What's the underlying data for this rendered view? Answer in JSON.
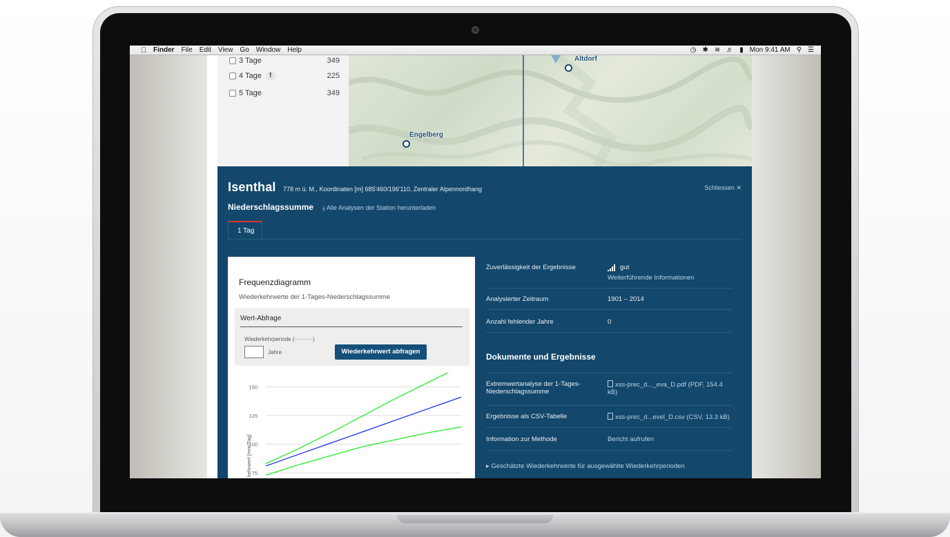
{
  "menubar": {
    "items": [
      "Finder",
      "File",
      "Edit",
      "View",
      "Go",
      "Window",
      "Help"
    ],
    "clock": "Mon 9:41 AM"
  },
  "checkboxes": [
    {
      "label": "3 Tage",
      "count": "349",
      "warn": ""
    },
    {
      "label": "4 Tage",
      "count": "225",
      "warn": "!"
    },
    {
      "label": "5 Tage",
      "count": "349",
      "warn": ""
    }
  ],
  "map": {
    "places": [
      "Altdorf",
      "Engelberg"
    ]
  },
  "station": {
    "name": "Isenthal",
    "meta": "778 m ü. M., Koordinaten [m] 685'460/196'110, Zentraler Alpennordhang",
    "close": "Schliessen",
    "subtitle": "Niederschlagssumme",
    "download": "Alle Analysen der Station herunterladen",
    "tab": "1 Tag"
  },
  "chart_card": {
    "title": "Frequenzdiagramm",
    "subtitle": "Wiederkehrwerte der 1-Tages-Niederschlagssumme",
    "query": {
      "title": "Wert-Abfrage",
      "label": "Wiederkehrperiode (··········)",
      "unit": "Jahre",
      "button": "Wiederkehrwert abfragen"
    }
  },
  "chart_data": {
    "type": "line",
    "ylabel": "kehrwert [mm/Tag]",
    "yticks": [
      75,
      100,
      125,
      150
    ],
    "ylim": [
      60,
      155
    ],
    "x": [
      0,
      1,
      2,
      3,
      4,
      5,
      6
    ],
    "series": [
      {
        "values": [
          81,
          91,
          101,
          111,
          121,
          131,
          141
        ],
        "color": "#2a3ee8"
      },
      {
        "values": [
          83,
          96,
          110,
          125,
          140,
          154,
          168
        ],
        "color": "#33ee33"
      },
      {
        "values": [
          73,
          82,
          90,
          98,
          104,
          110,
          115
        ],
        "color": "#33ee33"
      }
    ]
  },
  "info": {
    "reliability_label": "Zuverlässigkeit der Ergebnisse",
    "reliability_value": "gut",
    "reliability_link": "Weiterführende Informationen",
    "period_label": "Analysierter Zeitraum",
    "period_value": "1901 – 2014",
    "missing_label": "Anzahl fehlender Jahre",
    "missing_value": "0",
    "docs_title": "Dokumente und Ergebnisse",
    "doc1_label": "Extremwertanalyse der 1-Tages-Niederschlagssumme",
    "doc1_value": "xss-prec_d..._eva_D.pdf (PDF, 154.4 kB)",
    "doc2_label": "Ergebnisse als CSV-Tabelle",
    "doc2_value": "xss-prec_d...evel_D.csv (CSV, 13.3 kB)",
    "method_label": "Information zur Methode",
    "method_value": "Bericht aufrufen",
    "expand": "Geschätzte Wiederkehrwerte für ausgewählte Wiederkehrperioden"
  }
}
